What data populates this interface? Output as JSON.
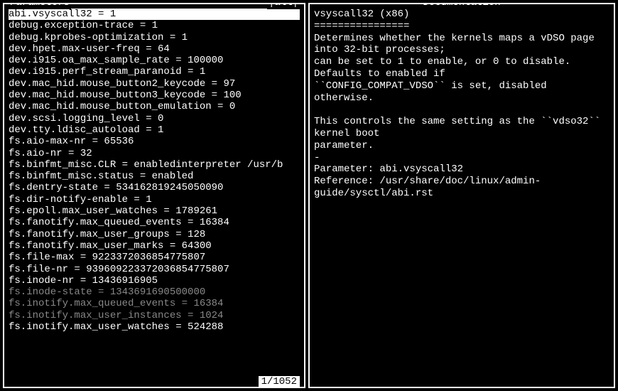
{
  "left_panel": {
    "title": "Parameters",
    "filter": "|all|",
    "parameters": [
      {
        "text": "abi.vsyscall32 = 1",
        "selected": true,
        "dimmed": false
      },
      {
        "text": "debug.exception-trace = 1",
        "selected": false,
        "dimmed": false
      },
      {
        "text": "debug.kprobes-optimization = 1",
        "selected": false,
        "dimmed": false
      },
      {
        "text": "dev.hpet.max-user-freq = 64",
        "selected": false,
        "dimmed": false
      },
      {
        "text": "dev.i915.oa_max_sample_rate = 100000",
        "selected": false,
        "dimmed": false
      },
      {
        "text": "dev.i915.perf_stream_paranoid = 1",
        "selected": false,
        "dimmed": false
      },
      {
        "text": "dev.mac_hid.mouse_button2_keycode = 97",
        "selected": false,
        "dimmed": false
      },
      {
        "text": "dev.mac_hid.mouse_button3_keycode = 100",
        "selected": false,
        "dimmed": false
      },
      {
        "text": "dev.mac_hid.mouse_button_emulation = 0",
        "selected": false,
        "dimmed": false
      },
      {
        "text": "dev.scsi.logging_level = 0",
        "selected": false,
        "dimmed": false
      },
      {
        "text": "dev.tty.ldisc_autoload = 1",
        "selected": false,
        "dimmed": false
      },
      {
        "text": "fs.aio-max-nr = 65536",
        "selected": false,
        "dimmed": false
      },
      {
        "text": "fs.aio-nr = 32",
        "selected": false,
        "dimmed": false
      },
      {
        "text": "fs.binfmt_misc.CLR = enabledinterpreter /usr/b",
        "selected": false,
        "dimmed": false
      },
      {
        "text": "fs.binfmt_misc.status = enabled",
        "selected": false,
        "dimmed": false
      },
      {
        "text": "fs.dentry-state = 534162819245050090",
        "selected": false,
        "dimmed": false
      },
      {
        "text": "fs.dir-notify-enable = 1",
        "selected": false,
        "dimmed": false
      },
      {
        "text": "fs.epoll.max_user_watches = 1789261",
        "selected": false,
        "dimmed": false
      },
      {
        "text": "fs.fanotify.max_queued_events = 16384",
        "selected": false,
        "dimmed": false
      },
      {
        "text": "fs.fanotify.max_user_groups = 128",
        "selected": false,
        "dimmed": false
      },
      {
        "text": "fs.fanotify.max_user_marks = 64300",
        "selected": false,
        "dimmed": false
      },
      {
        "text": "fs.file-max = 9223372036854775807",
        "selected": false,
        "dimmed": false
      },
      {
        "text": "fs.file-nr = 939609223372036854775807",
        "selected": false,
        "dimmed": false
      },
      {
        "text": "fs.inode-nr = 13436916905",
        "selected": false,
        "dimmed": false
      },
      {
        "text": "fs.inode-state = 1343691690500000",
        "selected": false,
        "dimmed": true
      },
      {
        "text": "fs.inotify.max_queued_events = 16384",
        "selected": false,
        "dimmed": true
      },
      {
        "text": "fs.inotify.max_user_instances = 1024",
        "selected": false,
        "dimmed": true
      },
      {
        "text": "fs.inotify.max_user_watches = 524288",
        "selected": false,
        "dimmed": false
      }
    ],
    "status": "1/1052"
  },
  "right_panel": {
    "title": "Documentation",
    "content": "vsyscall32 (x86)\n================\nDetermines whether the kernels maps a vDSO page into 32-bit processes;\ncan be set to 1 to enable, or 0 to disable. Defaults to enabled if\n``CONFIG_COMPAT_VDSO`` is set, disabled otherwise.\n\nThis controls the same setting as the ``vdso32`` kernel boot\nparameter.\n-\nParameter: abi.vsyscall32\nReference: /usr/share/doc/linux/admin-guide/sysctl/abi.rst"
  }
}
